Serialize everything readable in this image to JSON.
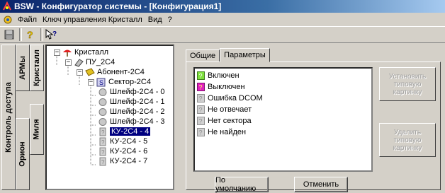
{
  "window": {
    "title": "BSW - Конфигуратор системы - [Конфигурация1]"
  },
  "menu": {
    "items": [
      "Файл",
      "Ключ управления Кристалл",
      "Вид",
      "?"
    ]
  },
  "toolbar": {
    "buttons": [
      "save-icon",
      "help-icon",
      "context-help-icon"
    ]
  },
  "vertical_tabs": {
    "kontrol": "Контроль доступа",
    "arm": "АРМы",
    "kristall": "Кристалл",
    "orion": "Орион",
    "milya": "Миля"
  },
  "tree": {
    "nodes": [
      {
        "label": "Кристалл",
        "icon": "umbrella-icon"
      },
      {
        "label": "ПУ_2С4",
        "icon": "tag-icon"
      },
      {
        "label": "Абонент-2С4",
        "icon": "subscriber-icon"
      },
      {
        "label": "Сектор-2С4",
        "icon": "sector-icon"
      },
      {
        "label": "Шлейф-2С4 - 0",
        "icon": "loop-icon"
      },
      {
        "label": "Шлейф-2С4 - 1",
        "icon": "loop-icon"
      },
      {
        "label": "Шлейф-2С4 - 2",
        "icon": "loop-icon"
      },
      {
        "label": "Шлейф-2С4 - 3",
        "icon": "loop-icon"
      },
      {
        "label": "КУ-2С4 - 4",
        "icon": "key-icon"
      },
      {
        "label": "КУ-2С4 - 5",
        "icon": "key-icon"
      },
      {
        "label": "КУ-2С4 - 6",
        "icon": "key-icon"
      },
      {
        "label": "КУ-2С4 - 7",
        "icon": "key-icon"
      }
    ],
    "selected": "КУ-2С4 - 4"
  },
  "tabs": {
    "general": "Общие",
    "params": "Параметры",
    "active": "Параметры"
  },
  "states": [
    {
      "label": "Включен",
      "color": "#7ee03c"
    },
    {
      "label": "Выключен",
      "color": "#e020c0"
    },
    {
      "label": "Ошибка DCOM",
      "color": "#b8b8b8"
    },
    {
      "label": "Не отвечает",
      "color": "#b8b8b8"
    },
    {
      "label": "Нет сектора",
      "color": "#b8b8b8"
    },
    {
      "label": "Не найден",
      "color": "#b8b8b8"
    }
  ],
  "buttons": {
    "set_default_picture": "Установить типовую картинку",
    "delete_default_picture": "Удалить типовую картинку",
    "defaults": "По умолчанию",
    "cancel": "Отменить"
  },
  "colors": {
    "titlebar_start": "#0a246a",
    "selection": "#000080",
    "face": "#d4d0c8"
  }
}
